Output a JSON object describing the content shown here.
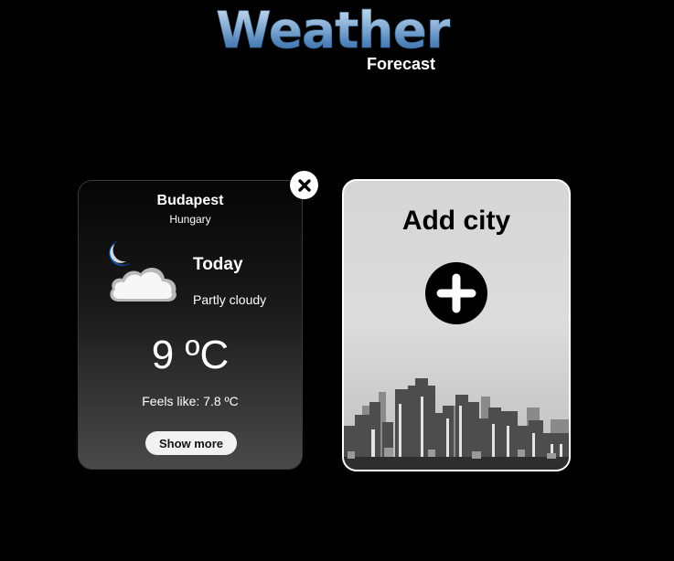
{
  "logo": {
    "title": "Weather",
    "subtitle": "Forecast"
  },
  "city_card": {
    "city": "Budapest",
    "country": "Hungary",
    "day": "Today",
    "condition": "Partly cloudy",
    "temperature": "9 ºC",
    "feels_like": "Feels like: 7.8 ºC",
    "show_more_label": "Show more",
    "icon": "moon-cloud-icon"
  },
  "add_card": {
    "title": "Add city",
    "icon": "plus-icon"
  },
  "close_icon": "close-icon",
  "colors": {
    "background": "#000000",
    "logo_blue": "#4f82b8",
    "moon_blue": "#1565c0"
  }
}
